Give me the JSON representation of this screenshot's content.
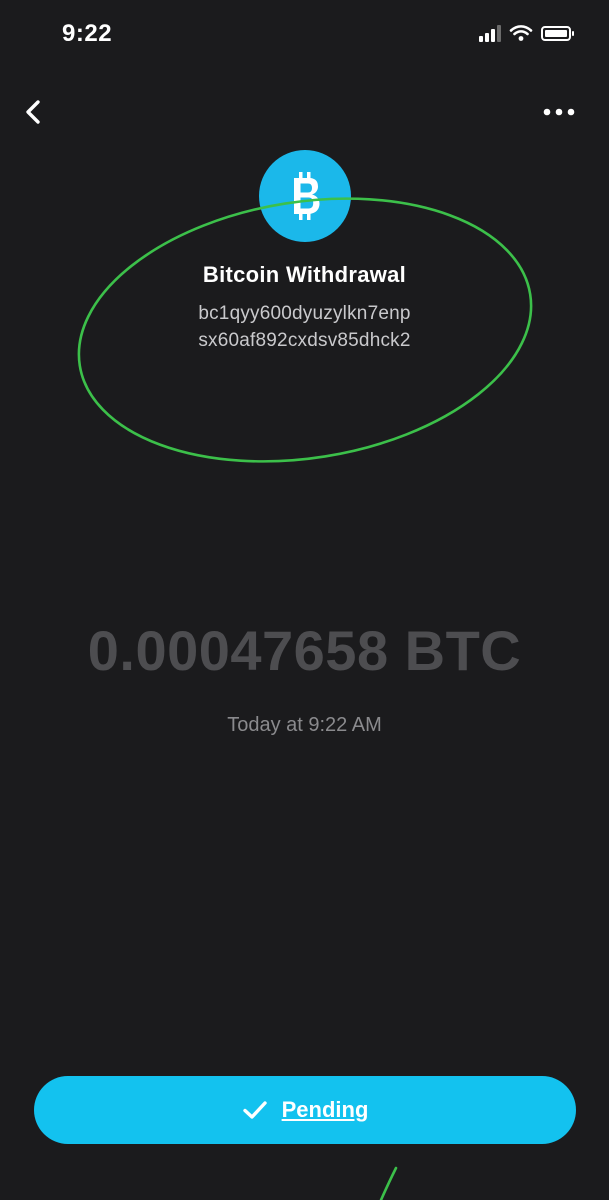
{
  "status_bar": {
    "time": "9:22"
  },
  "header": {
    "back_icon": "chevron-left-icon",
    "more_icon": "more-horizontal-icon"
  },
  "transaction": {
    "icon": "bitcoin-icon",
    "title": "Bitcoin Withdrawal",
    "address_line1": "bc1qyy600dyuzylkn7enp",
    "address_line2": "sx60af892cxdsv85dhck2",
    "amount": "0.00047658 BTC",
    "date": "Today at 9:22 AM"
  },
  "action": {
    "status_label": "Pending",
    "status_icon": "checkmark-icon"
  },
  "colors": {
    "background": "#1b1b1d",
    "accent": "#13c2ef",
    "bitcoin_avatar": "#1bb8ea",
    "annotation": "#3cc04a"
  }
}
